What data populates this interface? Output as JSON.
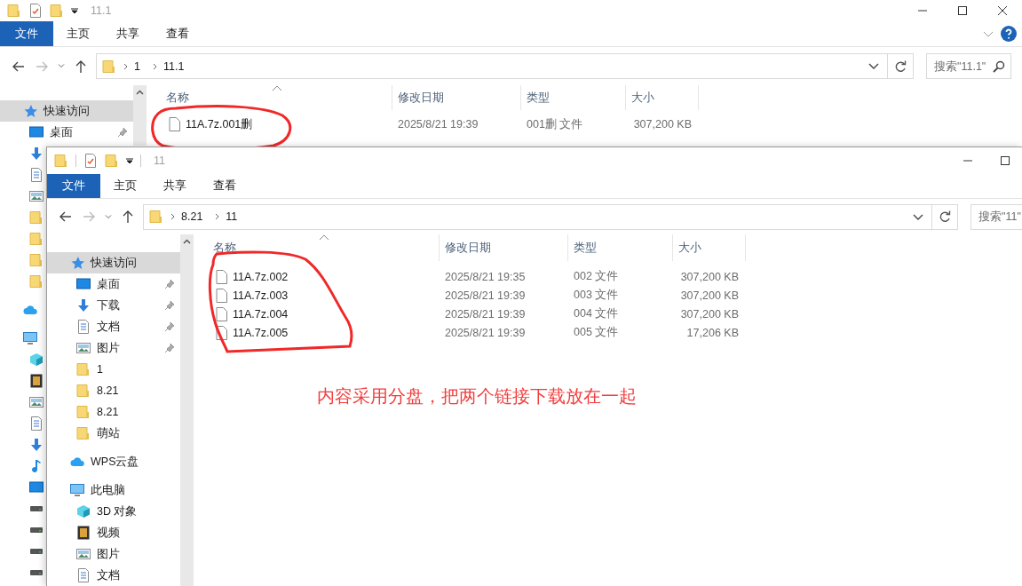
{
  "back_window": {
    "title": "11.1",
    "ribbon_tabs": [
      {
        "label": "文件",
        "selected": true
      },
      {
        "label": "主页",
        "selected": false
      },
      {
        "label": "共享",
        "selected": false
      },
      {
        "label": "查看",
        "selected": false
      }
    ],
    "path": [
      "1",
      "11.1"
    ],
    "search": {
      "placeholder": "搜索\"11.1\""
    },
    "columns": [
      "名称",
      "修改日期",
      "类型",
      "大小"
    ],
    "files": [
      {
        "name": "11A.7z.001删",
        "modified": "2025/8/21 19:39",
        "type": "001删 文件",
        "size": "307,200 KB"
      }
    ],
    "nav": [
      {
        "kind": "star",
        "label": "快速访问",
        "selected": true,
        "children": [
          {
            "kind": "desktop",
            "label": "桌面",
            "pinned": true,
            "selected": false
          },
          {
            "kind": "download",
            "selected": false
          },
          {
            "kind": "doc",
            "selected": false
          },
          {
            "kind": "picture",
            "selected": false
          },
          {
            "kind": "folder",
            "selected": false
          },
          {
            "kind": "folder",
            "selected": false
          },
          {
            "kind": "folder",
            "selected": false
          },
          {
            "kind": "folder",
            "selected": false
          }
        ]
      },
      {
        "kind": "cloud",
        "selected": false
      },
      {
        "kind": "pc",
        "selected": false,
        "children": [
          {
            "kind": "cube",
            "selected": false
          },
          {
            "kind": "film",
            "selected": false
          },
          {
            "kind": "picture",
            "selected": false
          },
          {
            "kind": "doc",
            "selected": false
          },
          {
            "kind": "download",
            "selected": false
          },
          {
            "kind": "music",
            "selected": false
          },
          {
            "kind": "desktop",
            "selected": false
          },
          {
            "kind": "drive",
            "selected": false
          },
          {
            "kind": "drive",
            "selected": false
          },
          {
            "kind": "drive",
            "selected": false
          },
          {
            "kind": "drive",
            "selected": false
          }
        ]
      }
    ]
  },
  "front_window": {
    "title": "11",
    "ribbon_tabs": [
      {
        "label": "文件",
        "selected": true
      },
      {
        "label": "主页",
        "selected": false
      },
      {
        "label": "共享",
        "selected": false
      },
      {
        "label": "查看",
        "selected": false
      }
    ],
    "path": [
      "8.21",
      "11"
    ],
    "search": {
      "placeholder": "搜索\"11\""
    },
    "columns": [
      "名称",
      "修改日期",
      "类型",
      "大小"
    ],
    "files": [
      {
        "name": "11A.7z.002",
        "modified": "2025/8/21 19:35",
        "type": "002 文件",
        "size": "307,200 KB"
      },
      {
        "name": "11A.7z.003",
        "modified": "2025/8/21 19:39",
        "type": "003 文件",
        "size": "307,200 KB"
      },
      {
        "name": "11A.7z.004",
        "modified": "2025/8/21 19:39",
        "type": "004 文件",
        "size": "307,200 KB"
      },
      {
        "name": "11A.7z.005",
        "modified": "2025/8/21 19:39",
        "type": "005 文件",
        "size": "17,206 KB"
      }
    ],
    "nav": [
      {
        "kind": "star",
        "label": "快速访问",
        "selected": true,
        "children": [
          {
            "kind": "desktop",
            "label": "桌面",
            "pinned": true,
            "selected": false
          },
          {
            "kind": "download",
            "label": "下载",
            "pinned": true,
            "selected": false
          },
          {
            "kind": "doc",
            "label": "文档",
            "pinned": true,
            "selected": false
          },
          {
            "kind": "picture",
            "label": "图片",
            "pinned": true,
            "selected": false
          },
          {
            "kind": "folder",
            "label": "1",
            "selected": false
          },
          {
            "kind": "folder",
            "label": "8.21",
            "selected": false
          },
          {
            "kind": "folder",
            "label": "8.21",
            "selected": false
          },
          {
            "kind": "folder",
            "label": "萌站",
            "selected": false
          }
        ]
      },
      {
        "kind": "cloud",
        "label": "WPS云盘",
        "selected": false
      },
      {
        "kind": "pc",
        "label": "此电脑",
        "selected": false,
        "children": [
          {
            "kind": "cube",
            "label": "3D 对象",
            "selected": false
          },
          {
            "kind": "film",
            "label": "视频",
            "selected": false
          },
          {
            "kind": "picture",
            "label": "图片",
            "selected": false
          },
          {
            "kind": "doc",
            "label": "文档",
            "selected": false
          }
        ]
      }
    ]
  },
  "annotation": {
    "note": "内容采用分盘，把两个链接下载放在一起"
  }
}
